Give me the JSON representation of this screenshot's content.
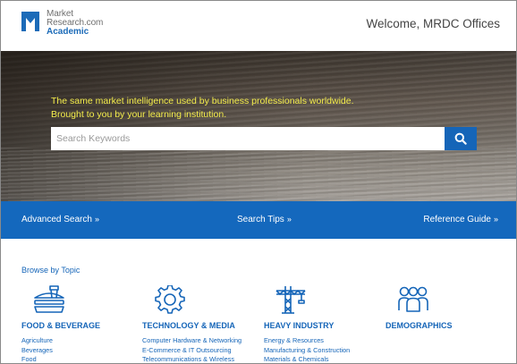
{
  "header": {
    "logo_line1": "Market",
    "logo_line2": "Research.com",
    "logo_line3": "Academic",
    "welcome": "Welcome, MRDC Offices"
  },
  "hero": {
    "tagline_line1": "The same market intelligence used by business professionals worldwide.",
    "tagline_line2": "Brought to you by your learning institution.",
    "search_placeholder": "Search Keywords"
  },
  "navbar": {
    "advanced_search": "Advanced Search",
    "search_tips": "Search Tips",
    "reference_guide": "Reference Guide",
    "chevron": "»"
  },
  "browse_title": "Browse by Topic",
  "topics": [
    {
      "title": "FOOD & BEVERAGE",
      "icon": "burger-icon",
      "links": [
        "Agriculture",
        "Beverages",
        "Food"
      ]
    },
    {
      "title": "TECHNOLOGY & MEDIA",
      "icon": "gear-icon",
      "links": [
        "Computer Hardware & Networking",
        "E-Commerce & IT Outsourcing",
        "Telecommunications & Wireless"
      ]
    },
    {
      "title": "HEAVY INDUSTRY",
      "icon": "crane-icon",
      "links": [
        "Energy & Resources",
        "Manufacturing & Construction",
        "Materials & Chemicals"
      ]
    },
    {
      "title": "DEMOGRAPHICS",
      "icon": "people-icon",
      "links": []
    }
  ],
  "colors": {
    "brand_blue": "#1468bd",
    "tagline_yellow": "#f3ec4b"
  }
}
